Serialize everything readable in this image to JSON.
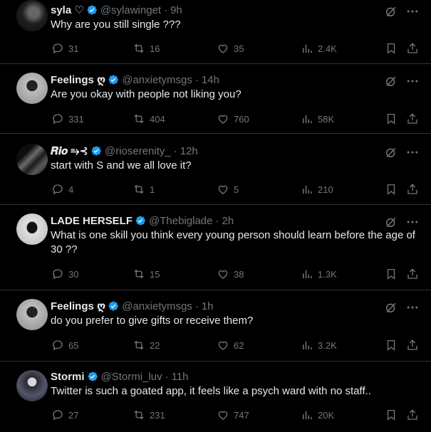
{
  "tweets": [
    {
      "name": "syla ♡",
      "handle": "@sylawinget",
      "dot": "·",
      "time": "9h",
      "text": "Why are you still single ???",
      "replies": "31",
      "retweets": "16",
      "likes": "35",
      "views": "2.4K",
      "avatar_color": "#2a2a2a"
    },
    {
      "name": "Feelings ღ",
      "handle": "@anxietymsgs",
      "dot": "·",
      "time": "14h",
      "text": "Are you okay with people not liking you?",
      "replies": "331",
      "retweets": "404",
      "likes": "760",
      "views": "58K",
      "avatar_color": "#9a9a9a"
    },
    {
      "name": "𝑹𝒊𝒐 ⥱⊰",
      "handle": "@rioserenity_",
      "dot": "·",
      "time": "12h",
      "text": "start with S and we all love it?",
      "replies": "4",
      "retweets": "1",
      "likes": "5",
      "views": "210",
      "avatar_color": "#444"
    },
    {
      "name": "LADE HERSELF",
      "handle": "@Thebiglade",
      "dot": "·",
      "time": "2h",
      "text": "What is one skill you think every young person should learn before the age of 30 ??",
      "replies": "30",
      "retweets": "15",
      "likes": "38",
      "views": "1.3K",
      "avatar_color": "#c9c9c9"
    },
    {
      "name": "Feelings ღ",
      "handle": "@anxietymsgs",
      "dot": "·",
      "time": "1h",
      "text": "do you prefer to give gifts or receive them?",
      "replies": "65",
      "retweets": "22",
      "likes": "62",
      "views": "3.2K",
      "avatar_color": "#9a9a9a"
    },
    {
      "name": "Stormi",
      "handle": "@Stormi_luv",
      "dot": "·",
      "time": "11h",
      "text": "Twitter is such a goated app, it feels like a psych ward with no staff..",
      "replies": "27",
      "retweets": "231",
      "likes": "747",
      "views": "20K",
      "avatar_color": "#3a3a44"
    }
  ],
  "colors": {
    "background": "#000000",
    "text": "#e7e9ea",
    "muted": "#71767b",
    "verified": "#1d9bf0",
    "border": "#2f3336"
  },
  "icons": [
    "grok-icon",
    "more-icon",
    "reply-icon",
    "retweet-icon",
    "like-icon",
    "views-icon",
    "bookmark-icon",
    "share-icon",
    "verified-badge-icon"
  ]
}
